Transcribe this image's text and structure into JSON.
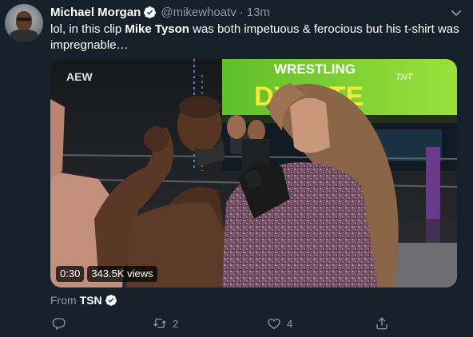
{
  "tweet": {
    "author_name": "Michael Morgan",
    "handle": "@mikewhoatv",
    "separator": "·",
    "time": "13m",
    "text_parts": {
      "p1": "lol, in this clip ",
      "bold": "Mike Tyson",
      "p2": " was both impetuous & ferocious but his t-shirt was impregnable…"
    }
  },
  "video": {
    "duration": "0:30",
    "views": "343.5K views",
    "overlay_text": {
      "aew": "AEW",
      "wrestling": "WRESTLING",
      "dynamite": "DY   MITE",
      "tnt": "TNT"
    }
  },
  "source": {
    "label": "From",
    "name": "TSN"
  },
  "actions": {
    "reply_count": "",
    "retweet_count": "2",
    "like_count": "4"
  },
  "colors": {
    "background": "#15202b",
    "secondary_text": "#8899a6",
    "verified": "#1da1f2"
  }
}
